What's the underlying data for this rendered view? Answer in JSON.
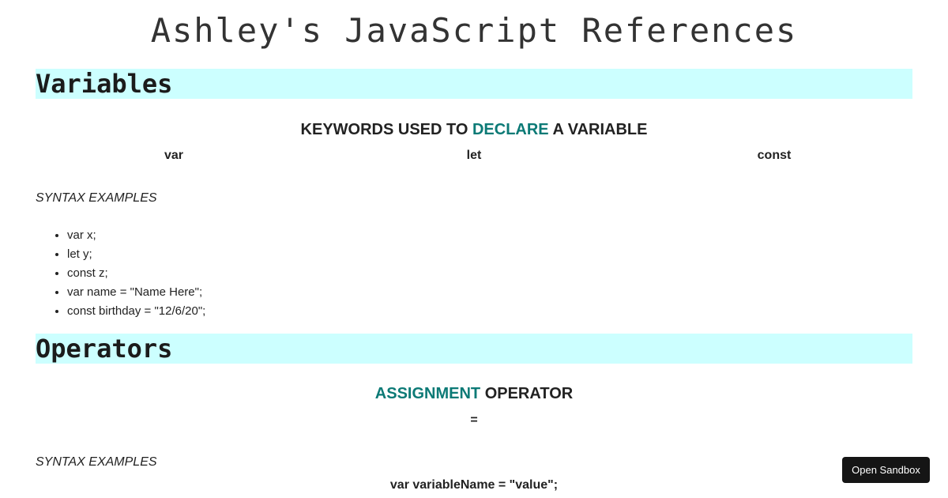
{
  "title": "Ashley's JavaScript References",
  "variables": {
    "heading": "Variables",
    "subheading": {
      "before": "KEYWORDS USED TO ",
      "accent": "DECLARE",
      "after": " A VARIABLE"
    },
    "keywords": [
      "var",
      "let",
      "const"
    ],
    "syntax_label": "SYNTAX EXAMPLES",
    "examples": [
      "var x;",
      "let y;",
      "const z;",
      "var name = \"Name Here\";",
      "const birthday = \"12/6/20\";"
    ]
  },
  "operators": {
    "heading": "Operators",
    "subheading": {
      "accent": "ASSIGNMENT",
      "after": " OPERATOR"
    },
    "symbol": "=",
    "syntax_label": "SYNTAX EXAMPLES",
    "example": "var variableName = \"value\";"
  },
  "sandbox_button": "Open Sandbox",
  "colors": {
    "section_background": "#ccffff",
    "accent": "#0c7a76",
    "button_background": "#151515"
  }
}
